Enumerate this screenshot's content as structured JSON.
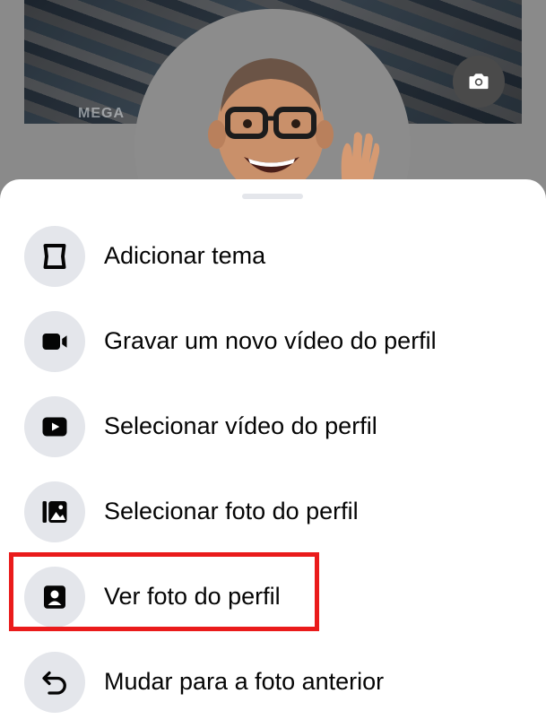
{
  "background": {
    "cover_label": "MEGA",
    "camera_icon": "camera-icon",
    "avatar": "memoji-avatar"
  },
  "sheet": {
    "items": [
      {
        "label": "Adicionar tema",
        "icon": "frame-icon"
      },
      {
        "label": "Gravar um novo vídeo do perfil",
        "icon": "video-camera-icon"
      },
      {
        "label": "Selecionar vídeo do perfil",
        "icon": "play-icon"
      },
      {
        "label": "Selecionar foto do perfil",
        "icon": "photo-gallery-icon"
      },
      {
        "label": "Ver foto do perfil",
        "icon": "profile-badge-icon",
        "highlighted": true
      },
      {
        "label": "Mudar para a foto anterior",
        "icon": "undo-arrow-icon"
      }
    ]
  },
  "colors": {
    "highlight": "#ea1b1b",
    "icon_bg": "#e4e6eb",
    "text": "#050505"
  }
}
